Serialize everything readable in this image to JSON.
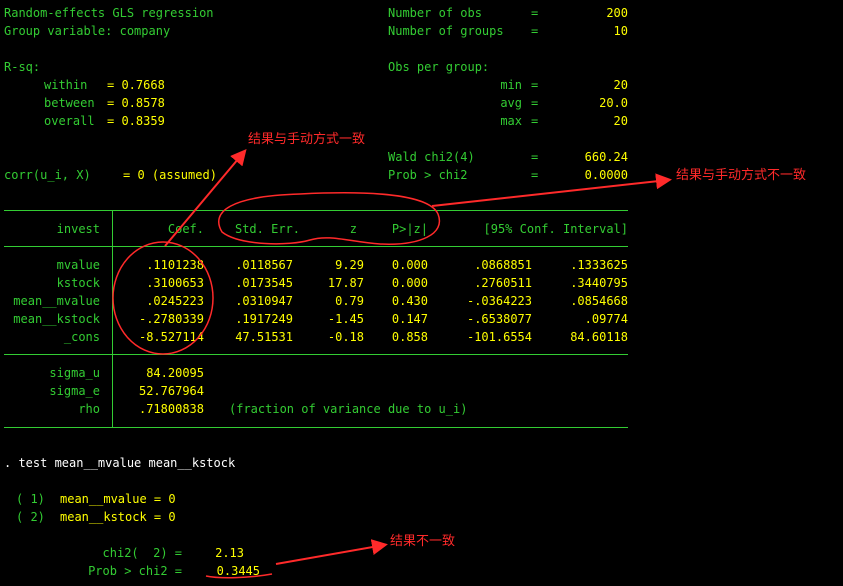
{
  "header": {
    "title": "Random-effects GLS regression",
    "group_var": "Group variable: company",
    "nobs_label": "Number of obs",
    "nobs_value": "200",
    "ngroups_label": "Number of groups",
    "ngroups_value": "10",
    "rsq_label": "R-sq:",
    "within_label": "within",
    "within_value": "= 0.7668",
    "between_label": "between",
    "between_value": "= 0.8578",
    "overall_label": "overall",
    "overall_value": "= 0.8359",
    "obs_per_group_label": "Obs per group:",
    "min_label": "min",
    "min_value": "20",
    "avg_label": "avg",
    "avg_value": "20.0",
    "max_label": "max",
    "max_value": "20",
    "wald_label": "Wald chi2(4)",
    "wald_value": "660.24",
    "corr_label": "corr(u_i, X)",
    "corr_value": "= 0 (assumed)",
    "prob_label": "Prob > chi2",
    "prob_value": "0.0000",
    "eq": "="
  },
  "table": {
    "depvar": "invest",
    "columns": [
      "Coef.",
      "Std. Err.",
      "z",
      "P>|z|",
      "[95% Conf. Interval]"
    ],
    "rows": [
      {
        "name": "mvalue",
        "coef": ".1101238",
        "se": ".0118567",
        "z": "9.29",
        "p": "0.000",
        "lo": ".0868851",
        "hi": ".1333625"
      },
      {
        "name": "kstock",
        "coef": ".3100653",
        "se": ".0173545",
        "z": "17.87",
        "p": "0.000",
        "lo": ".2760511",
        "hi": ".3440795"
      },
      {
        "name": "mean__mvalue",
        "coef": ".0245223",
        "se": ".0310947",
        "z": "0.79",
        "p": "0.430",
        "lo": "-.0364223",
        "hi": ".0854668"
      },
      {
        "name": "mean__kstock",
        "coef": "-.2780339",
        "se": ".1917249",
        "z": "-1.45",
        "p": "0.147",
        "lo": "-.6538077",
        "hi": ".09774"
      },
      {
        "name": "_cons",
        "coef": "-8.527114",
        "se": "47.51531",
        "z": "-0.18",
        "p": "0.858",
        "lo": "-101.6554",
        "hi": "84.60118"
      }
    ],
    "sigma_u_label": "sigma_u",
    "sigma_u_value": "84.20095",
    "sigma_e_label": "sigma_e",
    "sigma_e_value": "52.767964",
    "rho_label": "rho",
    "rho_value": ".71800838",
    "rho_note": "(fraction of variance due to u_i)"
  },
  "test": {
    "command": ". test mean__mvalue mean__kstock",
    "c1_num": "( 1)",
    "c1": "mean__mvalue = 0",
    "c2_num": "( 2)",
    "c2": "mean__kstock = 0",
    "chi2_label": "chi2(  2) =",
    "chi2_value": "2.13",
    "prob_label": "Prob > chi2 =",
    "prob_value": "0.3445"
  },
  "annotations": {
    "coef_note": "结果与手动方式一致",
    "se_note": "结果与手动方式不一致",
    "test_note": "结果不一致"
  },
  "colors": {
    "background": "#000000",
    "terminal_green": "#33cc33",
    "terminal_yellow": "#ffff00",
    "annotation_red": "#ff2a2a"
  }
}
